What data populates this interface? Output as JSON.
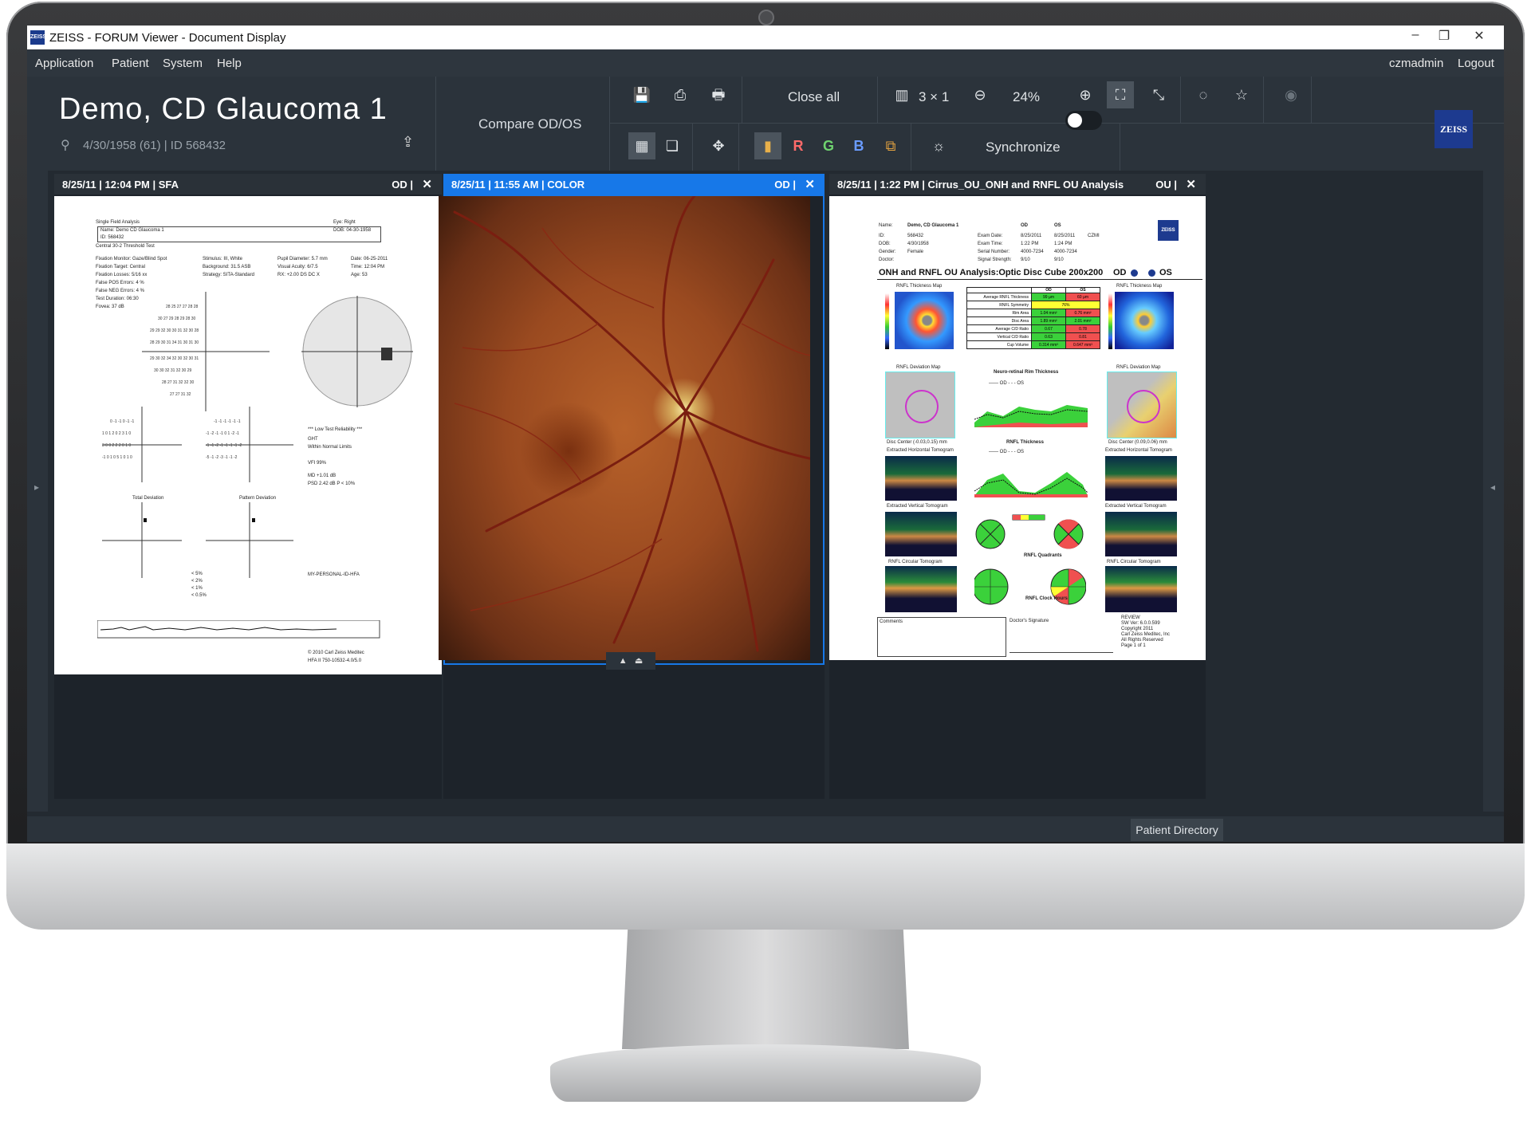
{
  "window": {
    "title": "ZEISS - FORUM Viewer - Document Display",
    "logo": "ZEISS"
  },
  "menu": {
    "items": [
      "Application",
      "Patient",
      "System",
      "Help"
    ],
    "user": "czmadmin",
    "logout": "Logout"
  },
  "patient": {
    "name": "Demo, CD Glaucoma 1",
    "info": "4/30/1958 (61) | ID 568432"
  },
  "toolbar": {
    "compare": "Compare OD/OS",
    "close_all": "Close all",
    "layout": "3 × 1",
    "zoom": "24%",
    "synchronize": "Synchronize",
    "channel_r": "R",
    "channel_g": "G",
    "channel_b": "B",
    "brand": "ZEISS"
  },
  "panels": [
    {
      "header": "8/25/11  |  12:04 PM  |  SFA",
      "eye": "OD  |",
      "close": "✕"
    },
    {
      "header": "8/25/11  |  11:55 AM  |  COLOR",
      "eye": "OD  |",
      "close": "✕"
    },
    {
      "header": "8/25/11  |  1:22 PM  |  Cirrus_OU_ONH and RNFL OU Analysis",
      "eye": "OU  |",
      "close": "✕"
    }
  ],
  "sfa": {
    "title": "Single Field Analysis",
    "eye": "Eye: Right",
    "name": "Name: Demo CD Glaucoma 1",
    "dob": "DOB: 04-30-1958",
    "id": "ID: 568432",
    "test": "Central 30-2 Threshold Test",
    "col1": [
      "Fixation Monitor: Gaze/Blind Spot",
      "Fixation Target: Central",
      "Fixation Losses: 5/16 xx",
      "False POS Errors: 4 %",
      "False NEG Errors: 4 %",
      "Test Duration: 06:30",
      "Fovea: 37 dB"
    ],
    "col2": [
      "Stimulus: III, White",
      "Background: 31.5 ASB",
      "Strategy: SITA-Standard"
    ],
    "col3": [
      "Pupil Diameter: 5.7 mm",
      "Visual Acuity: 6/7.5",
      "RX: +2.00 DS    DC X"
    ],
    "col4": [
      "Date: 06-25-2011",
      "Time: 12:04 PM",
      "Age: 53"
    ],
    "reliability": "*** Low Test Reliability ***",
    "ght": "GHT",
    "ght_value": "Within Normal Limits",
    "vfi": "VFI    99%",
    "md": "MD    +1.01 dB",
    "psd": "PSD    2.42 dB  P < 10%",
    "total_dev": "Total Deviation",
    "pattern_dev": "Pattern Deviation",
    "legend": [
      "< 5%",
      "< 2%",
      "< 1%",
      "< 0.5%"
    ],
    "personal_id": "MY-PERSONAL-ID-HFA",
    "copyright": "© 2010 Carl Zeiss Meditec",
    "hfa": "HFA II 750-10532-4.0/5.0"
  },
  "cirrus": {
    "name_label": "Name:",
    "name": "Demo, CD Glaucoma 1",
    "id_label": "ID:",
    "id": "568432",
    "dob_label": "DOB:",
    "dob": "4/30/1958",
    "gender_label": "Gender:",
    "gender": "Female",
    "doctor_label": "Doctor:",
    "od": "OD",
    "os": "OS",
    "exam_date_label": "Exam Date:",
    "exam_date_od": "8/25/2011",
    "exam_date_os": "8/25/2011",
    "exam_time_label": "Exam Time:",
    "exam_time_od": "1:22 PM",
    "exam_time_os": "1:24 PM",
    "serial_label": "Serial Number:",
    "serial_od": "4000-7234",
    "serial_os": "4000-7234",
    "signal_label": "Signal Strength:",
    "signal_od": "9/10",
    "signal_os": "9/10",
    "czmi": "CZMI",
    "title": "ONH and RNFL OU Analysis:Optic Disc Cube 200x200",
    "title_od": "OD",
    "title_os": "OS",
    "thickness_map": "RNFL Thickness Map",
    "deviation_map": "RNFL Deviation Map",
    "rim": "Neuro-retinal Rim Thickness",
    "rnfl_thickness": "RNFL Thickness",
    "table": {
      "headers": [
        "",
        "OD",
        "OS"
      ],
      "rows": [
        [
          "Average RNFL Thickness",
          "99 µm",
          "60 µm"
        ],
        [
          "RNFL Symmetry",
          "76%",
          ""
        ],
        [
          "Rim Area",
          "1.04 mm²",
          "0.76 mm²"
        ],
        [
          "Disc Area",
          "1.89 mm²",
          "2.01 mm²"
        ],
        [
          "Average C/D Ratio",
          "0.67",
          "0.78"
        ],
        [
          "Vertical C/D Ratio",
          "0.63",
          "0.81"
        ],
        [
          "Cup Volume",
          "0.314 mm³",
          "0.647 mm³"
        ]
      ]
    },
    "disc_center_od": "Disc Center (-0.03,0.15) mm",
    "disc_center_os": "Disc Center (0.09,0.06) mm",
    "horiz": "Extracted Horizontal Tomogram",
    "vert": "Extracted Vertical Tomogram",
    "circ": "RNFL Circular Tomogram",
    "quadrants": "RNFL Quadrants",
    "clock": "RNFL Clock Hours",
    "comments": "Comments",
    "signature": "Doctor's Signature",
    "review": [
      "REVIEW",
      "SW Ver: 6.0.0.599",
      "Copyright 2011",
      "Carl Zeiss Meditec, Inc",
      "All Rights Reserved",
      "Page 1 of 1"
    ],
    "legend": "—— OD  - - - OS"
  },
  "status": {
    "patient_directory": "Patient Directory"
  }
}
